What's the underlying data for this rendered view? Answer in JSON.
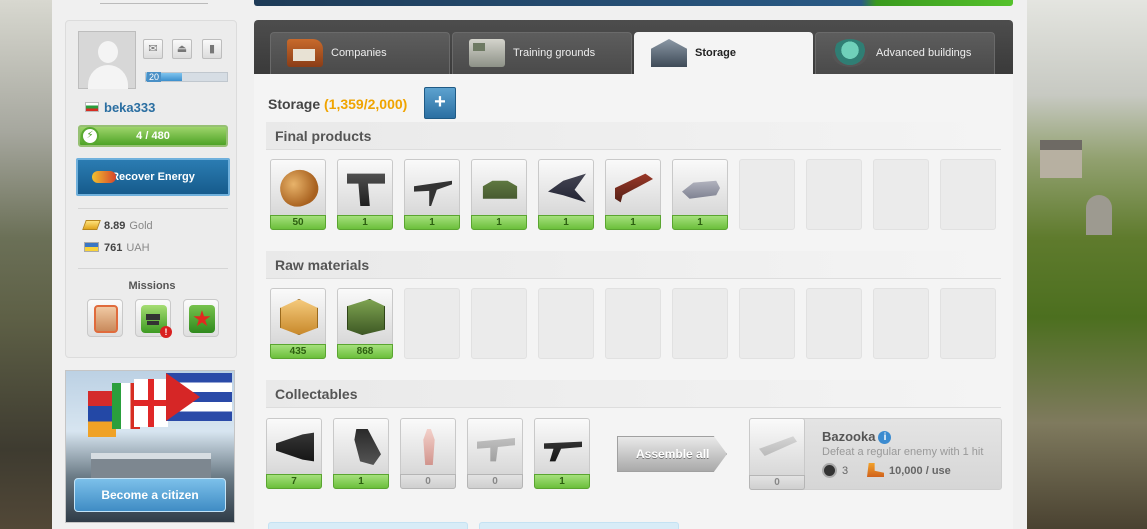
{
  "profile": {
    "username": "beka333",
    "level": "20",
    "xp_progress": 0.45,
    "energy": "4 / 480",
    "energy_fraction": 0.98,
    "recover_energy_label": "Recover Energy",
    "currencies": [
      {
        "amount": "8.89",
        "name": "Gold",
        "icon": "gold-bar-icon"
      },
      {
        "amount": "761",
        "name": "UAH",
        "icon": "ukraine-flag-icon"
      }
    ],
    "icons": [
      "mail-icon",
      "upload-icon",
      "stats-icon"
    ],
    "missions_title": "Missions"
  },
  "citizen": {
    "button_label": "Become a citizen"
  },
  "tabs": [
    {
      "label": "Companies",
      "icon": "companies-icon",
      "active": false
    },
    {
      "label": "Training grounds",
      "icon": "training-grounds-icon",
      "active": false
    },
    {
      "label": "Storage",
      "icon": "storage-icon",
      "active": true
    },
    {
      "label": "Advanced buildings",
      "icon": "advanced-buildings-icon",
      "active": false
    }
  ],
  "storage": {
    "title": "Storage",
    "capacity": "(1,359/2,000)",
    "add_label": "+"
  },
  "final_products": {
    "title": "Final products",
    "items": [
      {
        "icon": "bread-icon",
        "qty": "50"
      },
      {
        "icon": "pistol-icon",
        "qty": "1"
      },
      {
        "icon": "machine-gun-icon",
        "qty": "1"
      },
      {
        "icon": "tank-icon",
        "qty": "1"
      },
      {
        "icon": "jet-icon",
        "qty": "1"
      },
      {
        "icon": "rocket-launcher-icon",
        "qty": "1"
      },
      {
        "icon": "helicopter-icon",
        "qty": "1"
      }
    ],
    "total_slots": 11
  },
  "raw_materials": {
    "title": "Raw materials",
    "items": [
      {
        "icon": "food-crate-icon",
        "qty": "435"
      },
      {
        "icon": "weapon-crate-icon",
        "qty": "868"
      }
    ],
    "total_slots": 11
  },
  "collectables": {
    "title": "Collectables",
    "items": [
      {
        "icon": "scope-icon",
        "qty": "7"
      },
      {
        "icon": "flashlight-icon",
        "qty": "1"
      },
      {
        "icon": "rocket-part-icon",
        "qty": "0"
      },
      {
        "icon": "gun-part-icon",
        "qty": "0"
      },
      {
        "icon": "gun-stock-icon",
        "qty": "1"
      }
    ],
    "assemble_label": "Assemble all",
    "bazooka": {
      "name": "Bazooka",
      "qty": "0",
      "description": "Defeat a regular enemy with 1 hit",
      "kills": "3",
      "cost": "10,000 / use"
    }
  },
  "colors": {
    "accent_blue": "#2b6fa2",
    "capacity_orange": "#f0a400",
    "qty_green": "#6cbf3c"
  }
}
